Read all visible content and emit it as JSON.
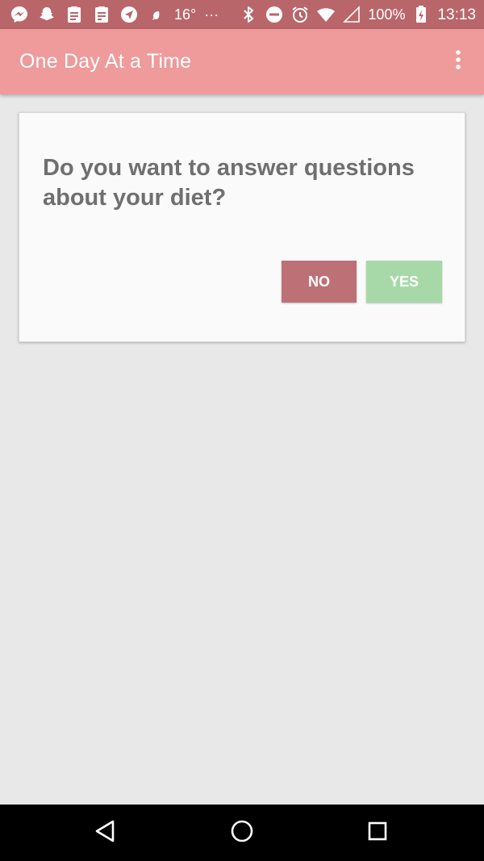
{
  "status_bar": {
    "temperature": "16°",
    "overflow_dots": "···",
    "battery_percent": "100%",
    "time": "13:13",
    "left_icons": [
      "messenger-icon",
      "snapchat-icon",
      "clipboard-icon",
      "clipboard-check-icon",
      "navigation-icon",
      "leaf-icon"
    ],
    "right_icons": [
      "bluetooth-icon",
      "do-not-disturb-icon",
      "alarm-icon",
      "wifi-icon",
      "signal-icon",
      "battery-charging-icon"
    ]
  },
  "app_bar": {
    "title": "One Day At a Time",
    "menu_icon": "more-vert-icon"
  },
  "card": {
    "question": "Do you want to answer questions about your diet?",
    "no_label": "NO",
    "yes_label": "YES"
  },
  "nav_bar": {
    "icons": [
      "back-icon",
      "home-icon",
      "recents-icon"
    ]
  },
  "colors": {
    "status_bar": "#b9666b",
    "app_bar": "#ef9a9b",
    "background": "#e8e8e8",
    "card": "#fafafa",
    "no_button": "#bd7176",
    "yes_button": "#a7d9a8",
    "question_text": "#6f6f6f"
  }
}
